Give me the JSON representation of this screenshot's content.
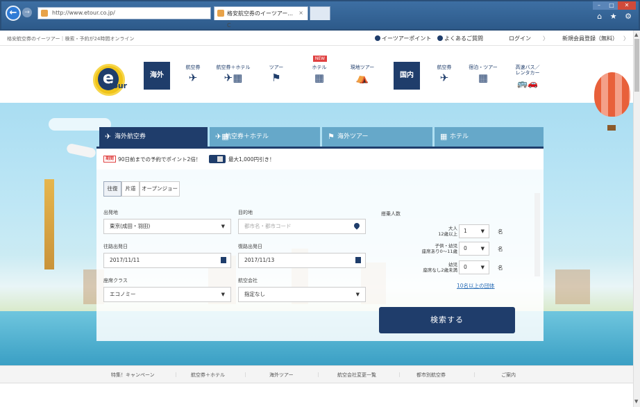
{
  "browser": {
    "url": "http://www.eto.co.jp/",
    "url_display": "http://www.etour.co.jp/",
    "tab_title": "格安航空券のイーツアー...",
    "tab_close": "×",
    "url_controls": "ρ ▾ C",
    "window_buttons": [
      "–",
      "□",
      "✕"
    ],
    "tool_icons": "⌂ ★ ⚙"
  },
  "utility": {
    "breadcrumb": "格安航空券のイーツアー｜検索・予約が24時間オンライン",
    "points": "イーツアーポイント",
    "faq": "よくあるご質問",
    "login": "ログイン",
    "register": "新規会員登録（無料）",
    "sep": "〉"
  },
  "logo": {
    "e": "e",
    "text": "tour"
  },
  "nav": {
    "overseas": "海外",
    "domestic": "国内",
    "new_badge": "NEW",
    "items": [
      {
        "label": "航空券",
        "icon": "plane-icon",
        "glyph": "✈"
      },
      {
        "label": "航空券＋ホテル",
        "icon": "plane-hotel-icon",
        "glyph": "✈▦"
      },
      {
        "label": "ツアー",
        "icon": "flag-icon",
        "glyph": "⚑"
      },
      {
        "label": "ホテル",
        "icon": "hotel-icon",
        "glyph": "▦"
      },
      {
        "label": "現地ツアー",
        "icon": "tent-icon",
        "glyph": "⛺"
      },
      {
        "label": "航空券",
        "icon": "plane-icon",
        "glyph": "✈"
      },
      {
        "label": "宿泊・ツアー",
        "icon": "hotel-icon",
        "glyph": "▦"
      },
      {
        "label": "高速バス／\nレンタカー",
        "icon": "bus-car-icon",
        "glyph": "🚌🚗"
      }
    ]
  },
  "panel": {
    "tabs": [
      {
        "label": "海外航空券",
        "glyph": "✈"
      },
      {
        "label": "航空券＋ホテル",
        "glyph": "✈▦"
      },
      {
        "label": "海外ツアー",
        "glyph": "⚑"
      },
      {
        "label": "ホテル",
        "glyph": "▦"
      }
    ],
    "promo_badge": "期間",
    "promo1": "90日前までの予約でポイント2倍！",
    "promo2": "最大1,000円引き！",
    "trip_types": [
      "往復",
      "片道",
      "オープンジョー"
    ],
    "labels": {
      "origin": "出発地",
      "destination": "目的地",
      "depart": "往路出発日",
      "return": "復路出発日",
      "class": "座席クラス",
      "airline": "航空会社",
      "passengers": "搭乗人数"
    },
    "values": {
      "origin": "東京(成田・羽田)",
      "destination_placeholder": "都市名・都市コード",
      "depart": "2017/11/11",
      "return": "2017/11/13",
      "class": "エコノミー",
      "airline": "指定なし"
    },
    "pax": [
      {
        "label": "大人\n12歳以上",
        "value": "1",
        "unit": "名"
      },
      {
        "label": "子供・幼児\n座席あり0～11歳",
        "value": "0",
        "unit": "名"
      },
      {
        "label": "幼児\n座席なし2歳未満",
        "value": "0",
        "unit": "名"
      }
    ],
    "more_link": "10名以上の団体",
    "search_button": "検索する",
    "caret": "▼"
  },
  "footer": {
    "items": [
      "特集！キャンペーン",
      "航空券＋ホテル",
      "海外ツアー",
      "航空会社変更一覧",
      "都市別航空券",
      "ご案内"
    ],
    "sep": "｜"
  }
}
